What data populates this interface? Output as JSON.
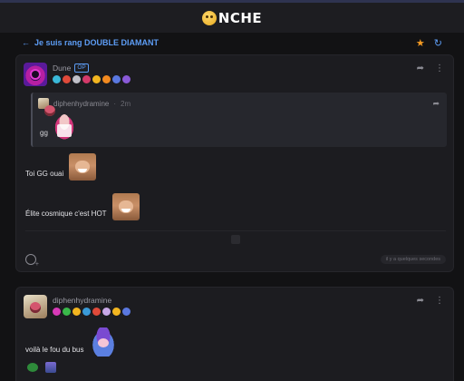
{
  "header": {
    "logo_text": "NCHE",
    "logo_emoji": "smiley-face-icon"
  },
  "topic": {
    "title": "Je suis rang DOUBLE DIAMANT",
    "back_icon": "arrow-left-icon",
    "star_icon": "star-icon",
    "refresh_icon": "refresh-icon"
  },
  "posts": [
    {
      "author": "Dune",
      "op_badge": "OP",
      "badge_colors": [
        "#3ab8d8",
        "#e04a3a",
        "#c0c0c8",
        "#d43a6a",
        "#f2b520",
        "#f28a20",
        "#5a78e0",
        "#8a5ad8"
      ],
      "quote": {
        "author": "diphenhydramine",
        "separator": "·",
        "time": "2m",
        "text": "gg"
      },
      "messages": [
        {
          "text": "Toi GG ouai"
        },
        {
          "text": "Élite cosmique c'est HOT"
        }
      ],
      "timestamp": "il y a quelques secondes"
    },
    {
      "author": "diphenhydramine",
      "badge_colors": [
        "#d83ab8",
        "#3ab84a",
        "#f2b520",
        "#3a9ad8",
        "#e04a3a",
        "#c8a8e8",
        "#f2b520",
        "#5a78e0"
      ],
      "messages": [
        {
          "text": "voilà le fou du bus"
        }
      ]
    }
  ],
  "colors": {
    "accent": "#5d9df5",
    "star": "#f59b23",
    "background": "#121214",
    "card": "#1c1c20"
  }
}
